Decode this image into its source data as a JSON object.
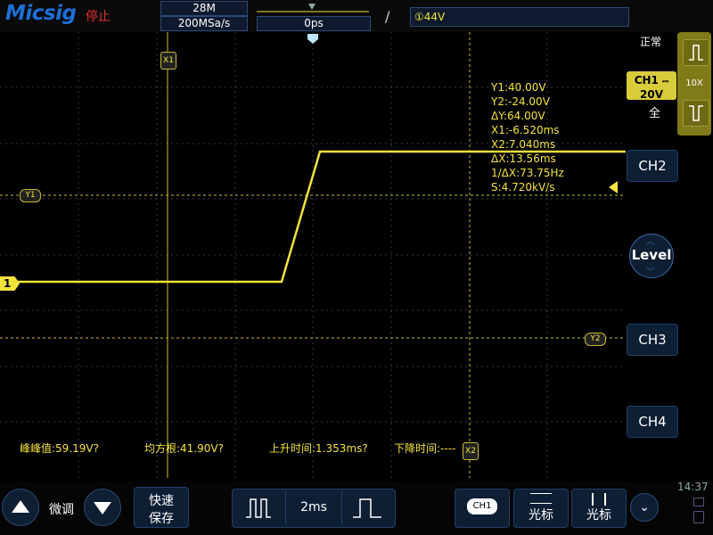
{
  "header": {
    "logo": "Micsig",
    "run_state": "停止",
    "memory_depth": "28M",
    "sample_rate": "200MSa/s",
    "trigger_position": "0ps",
    "trigger_slope_icon": "rising-edge-icon",
    "trigger_level": "①44V"
  },
  "right_panel": {
    "mode_label": "正常",
    "ch1_name": "CH1",
    "ch1_scale": "20V",
    "ch1_coupling": "全",
    "probe_ratio": "10X",
    "ch2_label": "CH2",
    "ch3_label": "CH3",
    "ch4_label": "CH4",
    "level_label": "Level"
  },
  "waveform": {
    "channel_marker": "1",
    "cursor_x1_label": "X1",
    "cursor_x2_label": "X2",
    "cursor_y1_label": "Y1",
    "cursor_y2_label": "Y2",
    "color": "#f3e33a"
  },
  "cursor_readout": {
    "y1": "Y1:40.00V",
    "y2": "Y2:-24.00V",
    "dy": "ΔY:64.00V",
    "x1": "X1:-6.520ms",
    "x2": "X2:7.040ms",
    "dx": "ΔX:13.56ms",
    "inv_dx": "1/ΔX:73.75Hz",
    "slope": "S:4.720kV/s"
  },
  "measurements": {
    "vpp": "峰峰值:59.19V?",
    "rms": "均方根:41.90V?",
    "rise_time": "上升时间:1.353ms?",
    "fall_time": "下降时间:----"
  },
  "bottom_bar": {
    "fine_label": "微调",
    "quick_save_line1": "快速",
    "quick_save_line2": "保存",
    "timebase": "2ms",
    "ch1_select": "CH1",
    "cursor_h_label": "光标",
    "cursor_v_label": "光标",
    "clock": "14:37"
  }
}
